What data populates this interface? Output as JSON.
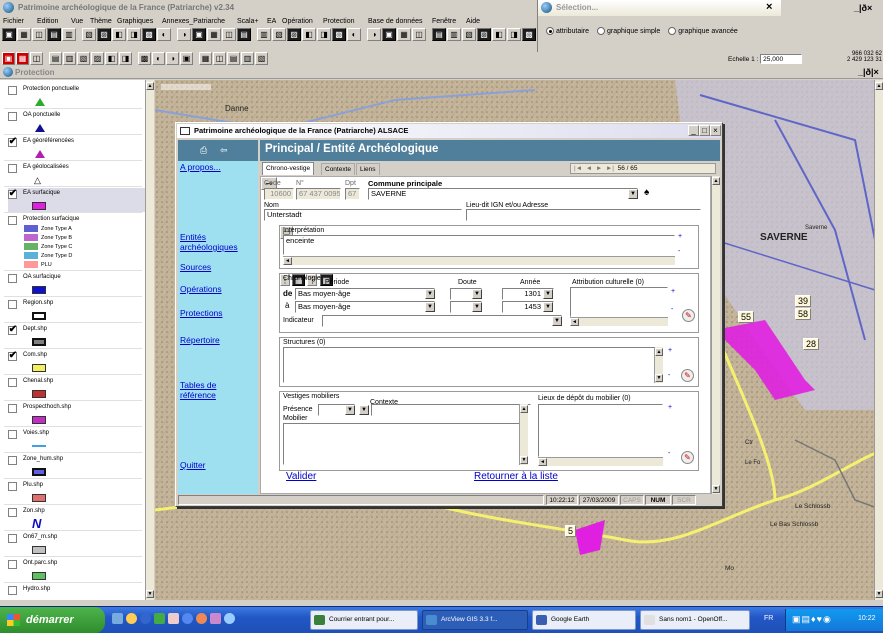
{
  "app": {
    "title": "Patrimoine archéologique de la France (Patriarche) v2.34",
    "menu": [
      "Fichier",
      "Edition",
      "Vue",
      "Thème",
      "Graphiques",
      "Annexes_Patriarche",
      "Scala+",
      "EA",
      "Opération",
      "Protection",
      "Base de données",
      "Fenêtre",
      "Aide"
    ],
    "scale_label": "Echelle 1 :",
    "scale_value": "25,000",
    "coords_x": "966 032 62",
    "coords_y": "2 429 123 31"
  },
  "selection_panel": {
    "title": "Sélection...",
    "options": [
      "attributaire",
      "graphique simple",
      "graphique avancée"
    ]
  },
  "view_window": {
    "title": "Protection"
  },
  "toc": {
    "items": [
      {
        "label": "Protection ponctuelle",
        "checked": false,
        "swatch": "#2eaa2e",
        "shape": "triangle"
      },
      {
        "label": "OA ponctuelle",
        "checked": false,
        "swatch": "#101090",
        "shape": "triangle"
      },
      {
        "label": "EA géoréférencées",
        "checked": true,
        "swatch": "#b020b0",
        "shape": "triangle"
      },
      {
        "label": "EA géolocalisées",
        "checked": false,
        "swatch": "#ffffff",
        "shape": "triangle-outline"
      },
      {
        "label": "EA surfacique",
        "checked": true,
        "swatch": "#e020e0",
        "shape": "rect"
      },
      {
        "label": "Protection surfacique",
        "checked": false,
        "shape": "legend"
      },
      {
        "label": "OA surfacique",
        "checked": false,
        "swatch": "#1010d0",
        "shape": "rect"
      },
      {
        "label": "Region.shp",
        "checked": false,
        "swatch": "#ffffff",
        "shape": "rect-outline"
      },
      {
        "label": "Dept.shp",
        "checked": true,
        "swatch": "#808080",
        "shape": "rect-outline"
      },
      {
        "label": "Com.shp",
        "checked": true,
        "swatch": "#f0f060",
        "shape": "rect"
      },
      {
        "label": "Chenal.shp",
        "checked": false,
        "swatch": "#c03030",
        "shape": "rect"
      },
      {
        "label": "Prospecthoch.shp",
        "checked": false,
        "swatch": "#c030c0",
        "shape": "rect"
      },
      {
        "label": "Voies.shp",
        "checked": false,
        "swatch": "#40a0e0",
        "shape": "line"
      },
      {
        "label": "Zone_hum.shp",
        "checked": false,
        "swatch": "#6060e0",
        "shape": "rect-outline"
      },
      {
        "label": "Plu.shp",
        "checked": false,
        "swatch": "#e07070",
        "shape": "rect"
      },
      {
        "label": "Zon.shp",
        "checked": false,
        "swatch": "#1010c0",
        "shape": "zigzag"
      },
      {
        "label": "On67_m.shp",
        "checked": false,
        "swatch": "#c0c0c0",
        "shape": "rect"
      },
      {
        "label": "Ont.parc.shp",
        "checked": false,
        "swatch": "#60c060",
        "shape": "rect"
      },
      {
        "label": "Hydro.shp",
        "checked": false,
        "swatch": "#60a0ff",
        "shape": "line"
      }
    ],
    "legend": [
      {
        "label": "Zone Type A",
        "color": "#3838c8"
      },
      {
        "label": "Zone Type B",
        "color": "#b040c0"
      },
      {
        "label": "Zone Type C",
        "color": "#40a040"
      },
      {
        "label": "Zone Type D",
        "color": "#30a0d0"
      },
      {
        "label": "PLU",
        "color": "#ff8080"
      }
    ]
  },
  "map_labels": {
    "town1": "SAVERNE",
    "town2": "Danne",
    "town3": "Saverne",
    "ctr": "Ctr",
    "lf": "Le Fo",
    "bs": "Le Bas Schlossb",
    "ls": "Le Schlossb",
    "mo": "Mo",
    "labels": [
      "39",
      "58",
      "55",
      "28",
      "5"
    ]
  },
  "form": {
    "window_title": "Patrimoine archéologique de la France (Patriarche) ALSACE",
    "header": "Principal / Entité Archéologique",
    "nav": [
      "A propos...",
      "Entités archéologiques",
      "Sources",
      "Opérations",
      "Protections",
      "Répertoire",
      "Tables de référence",
      "Quitter"
    ],
    "tabs": [
      "Chrono-vestige",
      "Contexte",
      "Liens"
    ],
    "record_counter": "56 / 65",
    "code_label": "Code",
    "code": "10600",
    "num_label": "N°",
    "num": "67 437 0095",
    "dpt_label": "Dpt",
    "dpt": "67",
    "commune_label": "Commune principale",
    "commune": "SAVERNE",
    "nom_label": "Nom",
    "nom": "Unterstadt",
    "lieudit_label": "Lieu-dit IGN et/ou Adresse",
    "lieudit": "",
    "interpretation_label": "Interprétation",
    "interpretation": "enceinte",
    "chrono": {
      "label": "Chronologie",
      "periode_label": "Période",
      "doute_label": "Doute",
      "annee_label": "Année",
      "attribution_label": "Attribution culturelle",
      "attribution_count": "(0)",
      "de_label": "de",
      "a_label": "à",
      "periode_de": "Bas moyen-âge",
      "periode_a": "Bas moyen-âge",
      "annee_de": "1301",
      "annee_a": "1453",
      "indicateur_label": "Indicateur"
    },
    "structures_label": "Structures",
    "structures_count": "(0)",
    "vestiges": {
      "label": "Vestiges mobiliers",
      "presence_label": "Présence",
      "contexte_label": "Contexte",
      "mobilier_label": "Mobilier",
      "lieux_label": "Lieux de dépôt du mobilier",
      "lieux_count": "(0)"
    },
    "valider": "Valider",
    "retourner": "Retourner à la liste",
    "status": {
      "time": "10:22:12",
      "date": "27/03/2009",
      "caps": "CAPS",
      "num": "NUM",
      "scr": "SCR"
    }
  },
  "taskbar": {
    "start": "démarrer",
    "buttons": [
      {
        "label": "Courrier entrant pour...",
        "active": false
      },
      {
        "label": "ArcView GIS 3.3 f...",
        "active": true
      },
      {
        "label": "Google Earth",
        "active": false
      },
      {
        "label": "Sans nom1 - OpenOff...",
        "active": false
      }
    ],
    "lang": "FR",
    "clock": "10:22"
  }
}
